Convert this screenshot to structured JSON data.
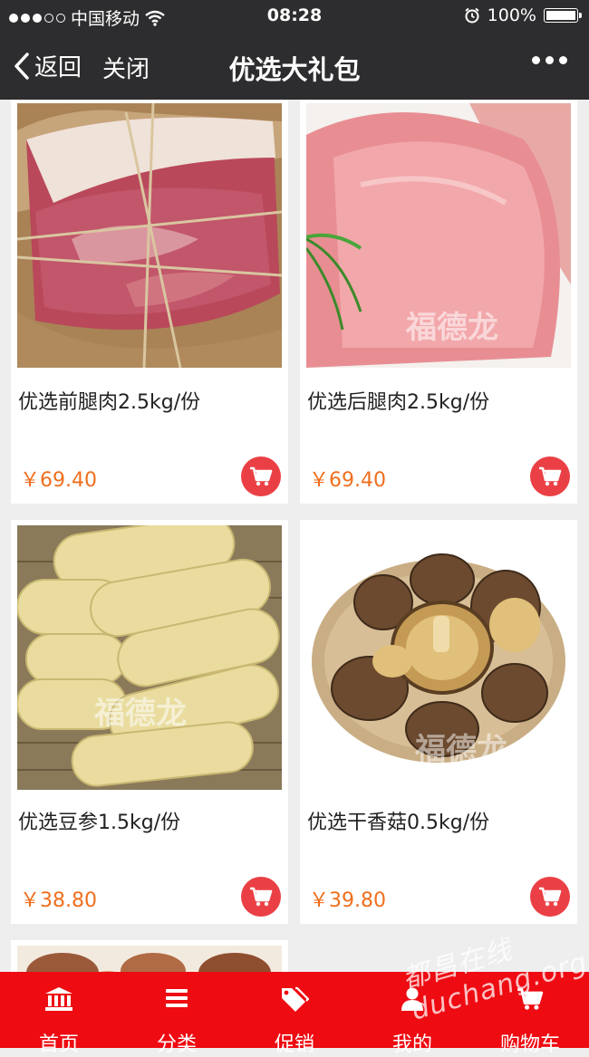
{
  "status_bar": {
    "carrier": "中国移动",
    "time": "08:28",
    "battery": "100%"
  },
  "nav": {
    "back_label": "返回",
    "close_label": "关闭",
    "title": "优选大礼包"
  },
  "products": [
    {
      "name": "优选前腿肉2.5kg/份",
      "price": "￥69.40"
    },
    {
      "name": "优选后腿肉2.5kg/份",
      "price": "￥69.40",
      "watermark": "福德龙"
    },
    {
      "name": "优选豆参1.5kg/份",
      "price": "￥38.80",
      "watermark": "福德龙"
    },
    {
      "name": "优选干香菇0.5kg/份",
      "price": "￥39.80",
      "watermark": "福德龙"
    }
  ],
  "tabs": [
    {
      "label": "首页",
      "icon": "bank-icon"
    },
    {
      "label": "分类",
      "icon": "list-icon"
    },
    {
      "label": "促销",
      "icon": "tags-icon"
    },
    {
      "label": "我的",
      "icon": "user-icon"
    },
    {
      "label": "购物车",
      "icon": "cart-icon"
    }
  ],
  "site_watermark": "都昌在线 duchang.org",
  "colors": {
    "top_bar": "#2d2d2f",
    "tab_bar": "#ee0b12",
    "price": "#ef6f1e",
    "cart_button": "#ea4045"
  }
}
